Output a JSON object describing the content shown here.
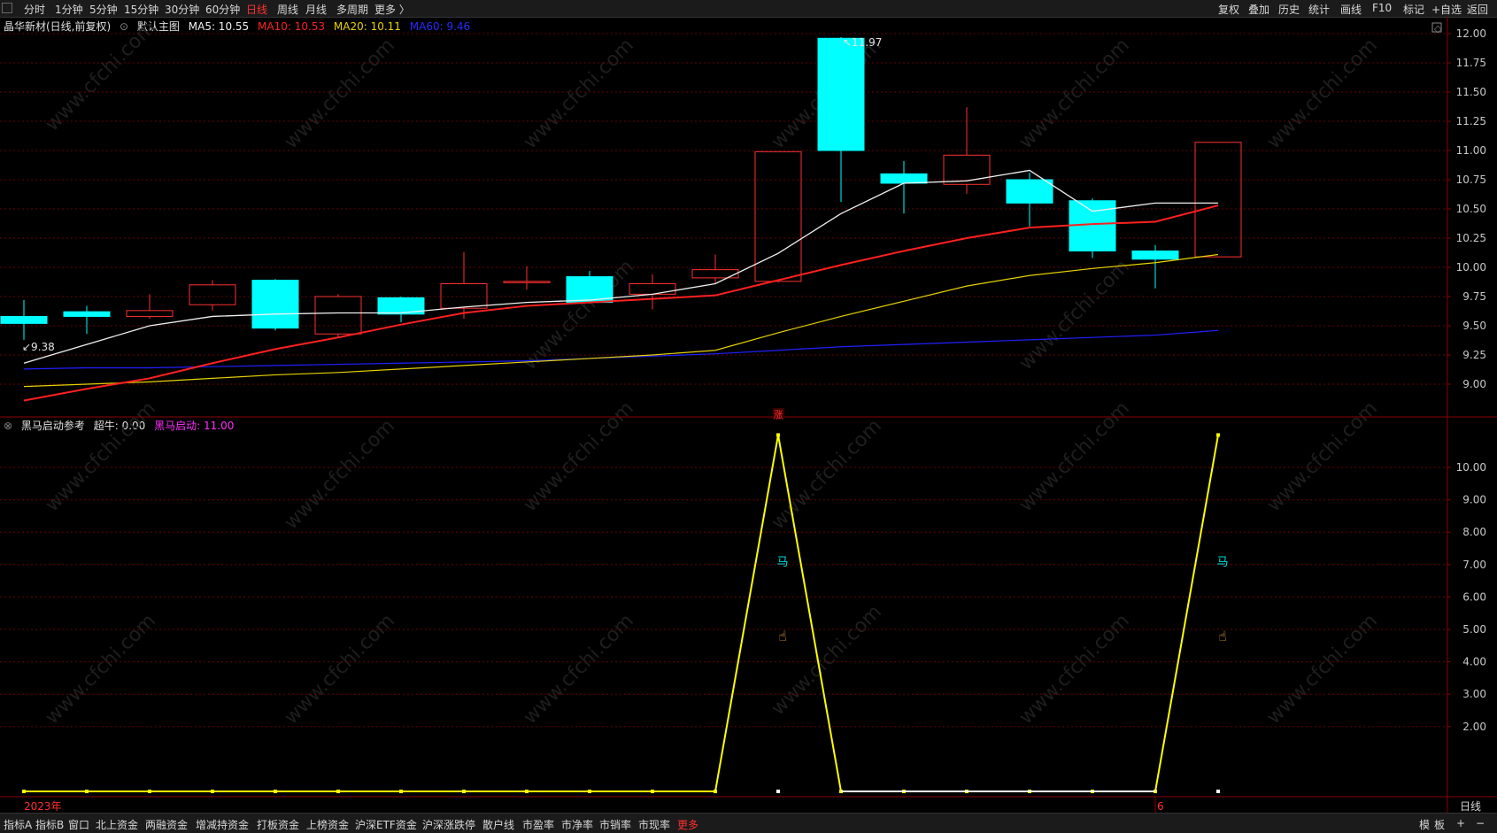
{
  "top_tabs": [
    "分时",
    "1分钟",
    "5分钟",
    "15分钟",
    "30分钟",
    "60分钟",
    "日线",
    "周线",
    "月线",
    "多周期",
    "更多 〉"
  ],
  "top_active": 6,
  "right_tabs": [
    "复权",
    "叠加",
    "历史",
    "统计",
    "画线",
    "F10",
    "标记",
    "+自选",
    "返回"
  ],
  "info": {
    "stock": "晶华新材(日线,前复权)",
    "main": "默认主图",
    "ma5": "MA5: 10.55",
    "ma10": "MA10: 10.53",
    "ma20": "MA20: 10.11",
    "ma60": "MA60: 9.46"
  },
  "sub_info": {
    "name": "黑马启动参考",
    "chaoniu": "超牛: 0.00",
    "heima": "黑马启动: 11.00"
  },
  "bottom_tabs": [
    "指标A",
    "指标B",
    "窗口",
    "北上资金",
    "两融资金",
    "增减持资金",
    "打板资金",
    "上榜资金",
    "沪深ETF资金",
    "沪深涨跌停",
    "散户线",
    "市盈率",
    "市净率",
    "市销率",
    "市现率",
    "更多"
  ],
  "bottom_active": 15,
  "bottom_right": [
    "模",
    "板",
    "+",
    "−"
  ],
  "period_label": "日线",
  "colors": {
    "up": "#ff3030",
    "down": "#00ffff",
    "ma5": "#f0f0f0",
    "ma10": "#ff2020",
    "ma20": "#e6d200",
    "ma60": "#2020ff",
    "signal": "#ffff00",
    "grid": "#6a0000"
  },
  "chart_data": [
    {
      "type": "candlestick",
      "y_ticks": [
        "12.00",
        "11.75",
        "11.50",
        "11.25",
        "11.00",
        "10.75",
        "10.50",
        "10.25",
        "10.00",
        "9.75",
        "9.50",
        "9.25",
        "9.00"
      ],
      "ylim": [
        8.86,
        12.05
      ],
      "annotations": {
        "high_label": "11.97",
        "low_label": "9.38",
        "limit_up_mark": "涨"
      },
      "candles": [
        {
          "o": 9.58,
          "h": 9.72,
          "l": 9.38,
          "c": 9.52
        },
        {
          "o": 9.62,
          "h": 9.67,
          "l": 9.43,
          "c": 9.58
        },
        {
          "o": 9.58,
          "h": 9.77,
          "l": 9.56,
          "c": 9.63
        },
        {
          "o": 9.68,
          "h": 9.89,
          "l": 9.63,
          "c": 9.85
        },
        {
          "o": 9.89,
          "h": 9.9,
          "l": 9.46,
          "c": 9.48
        },
        {
          "o": 9.43,
          "h": 9.77,
          "l": 9.4,
          "c": 9.75
        },
        {
          "o": 9.74,
          "h": 9.75,
          "l": 9.53,
          "c": 9.6
        },
        {
          "o": 9.65,
          "h": 10.13,
          "l": 9.56,
          "c": 9.86
        },
        {
          "o": 9.87,
          "h": 10.01,
          "l": 9.81,
          "c": 9.88
        },
        {
          "o": 9.92,
          "h": 9.97,
          "l": 9.69,
          "c": 9.7
        },
        {
          "o": 9.77,
          "h": 9.94,
          "l": 9.64,
          "c": 9.86
        },
        {
          "o": 9.91,
          "h": 10.11,
          "l": 9.86,
          "c": 9.98
        },
        {
          "o": 9.88,
          "h": 10.99,
          "l": 9.87,
          "c": 10.99
        },
        {
          "o": 11.96,
          "h": 11.97,
          "l": 10.56,
          "c": 11.0
        },
        {
          "o": 10.8,
          "h": 10.91,
          "l": 10.46,
          "c": 10.72
        },
        {
          "o": 10.71,
          "h": 11.37,
          "l": 10.63,
          "c": 10.96
        },
        {
          "o": 10.75,
          "h": 10.81,
          "l": 10.35,
          "c": 10.55
        },
        {
          "o": 10.57,
          "h": 10.59,
          "l": 10.08,
          "c": 10.14
        },
        {
          "o": 10.14,
          "h": 10.19,
          "l": 9.82,
          "c": 10.07
        },
        {
          "o": 10.09,
          "h": 11.07,
          "l": 10.09,
          "c": 11.07
        }
      ],
      "ma5": [
        9.18,
        9.34,
        9.5,
        9.58,
        9.6,
        9.61,
        9.61,
        9.66,
        9.7,
        9.72,
        9.77,
        9.86,
        10.12,
        10.46,
        10.72,
        10.74,
        10.83,
        10.48,
        10.55,
        10.55
      ],
      "ma10": [
        8.86,
        8.96,
        9.05,
        9.18,
        9.3,
        9.4,
        9.51,
        9.61,
        9.67,
        9.7,
        9.73,
        9.76,
        9.89,
        10.02,
        10.14,
        10.25,
        10.34,
        10.37,
        10.39,
        10.53
      ],
      "ma20": [
        8.98,
        9.0,
        9.02,
        9.05,
        9.08,
        9.1,
        9.13,
        9.16,
        9.19,
        9.22,
        9.25,
        9.29,
        9.44,
        9.58,
        9.71,
        9.84,
        9.93,
        9.99,
        10.04,
        10.11
      ],
      "ma60": [
        9.13,
        9.14,
        9.14,
        9.15,
        9.16,
        9.17,
        9.18,
        9.19,
        9.2,
        9.22,
        9.24,
        9.26,
        9.29,
        9.32,
        9.34,
        9.36,
        9.38,
        9.4,
        9.42,
        9.46
      ]
    },
    {
      "type": "line",
      "title": "黑马启动参考",
      "y_ticks": [
        "10.00",
        "9.00",
        "8.00",
        "7.00",
        "6.00",
        "5.00",
        "4.00",
        "3.00",
        "2.00"
      ],
      "ylim": [
        0,
        11.3
      ],
      "x_labels": [
        "2023年",
        "6"
      ],
      "series": [
        {
          "name": "黑马启动",
          "values": [
            0,
            0,
            0,
            0,
            0,
            0,
            0,
            0,
            0,
            0,
            0,
            0,
            11,
            0,
            0,
            0,
            0,
            0,
            0,
            11
          ]
        },
        {
          "name": "超牛",
          "values": [
            0,
            0,
            0,
            0,
            0,
            0,
            0,
            0,
            0,
            0,
            0,
            0,
            0,
            0,
            0,
            0,
            0,
            0,
            0,
            0
          ]
        }
      ],
      "markers": [
        {
          "bar": 12,
          "text": "马"
        },
        {
          "bar": 19,
          "text": "马"
        }
      ]
    }
  ],
  "watermark": "www.cfchi.com"
}
